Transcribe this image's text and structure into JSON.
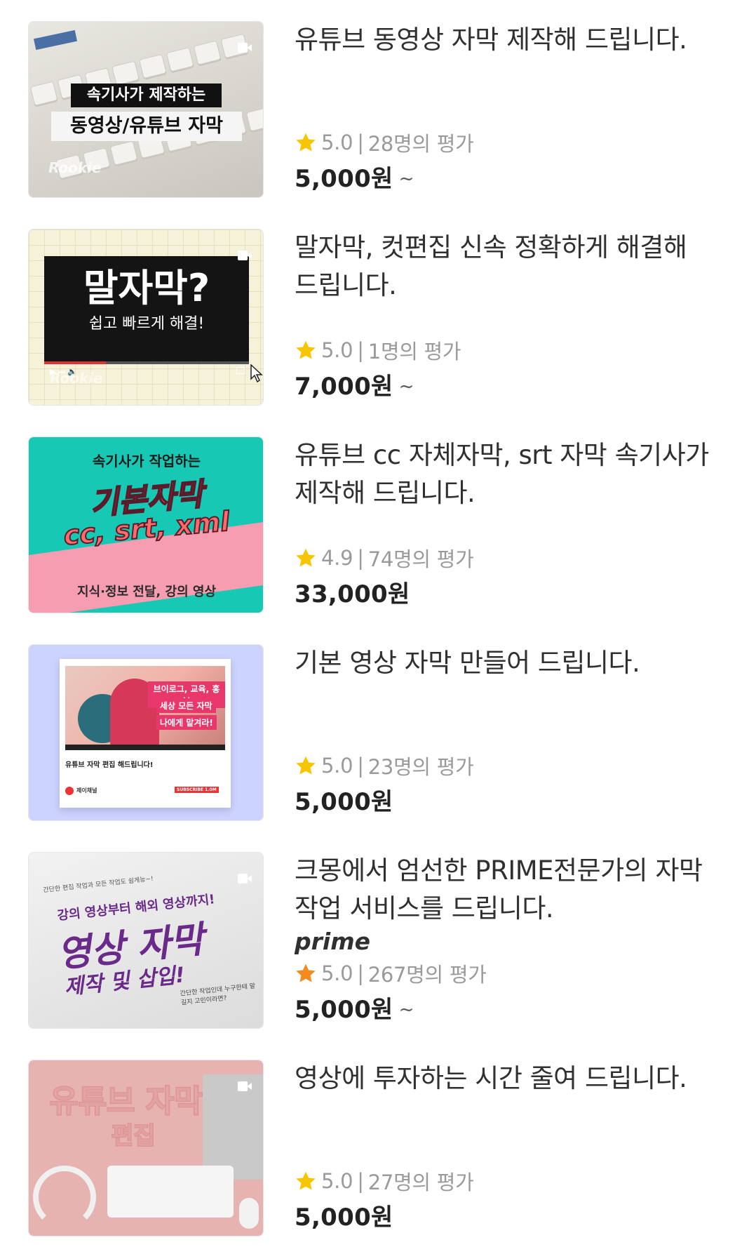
{
  "items": [
    {
      "title": "유튜브 동영상 자막 제작해 드립니다.",
      "rating": "5.0",
      "reviews": "28명의 평가",
      "price": "5,000원",
      "tilde": "~",
      "thumb": {
        "line1": "속기사가 제작하는",
        "line2": "동영상/유튜브 자막",
        "watermark": "Rookie"
      }
    },
    {
      "title": "말자막, 컷편집 신속 정확하게 해결해 드립니다.",
      "rating": "5.0",
      "reviews": "1명의 평가",
      "price": "7,000원",
      "tilde": "~",
      "thumb": {
        "line1": "말자막?",
        "line2": "쉽고 빠르게 해결!",
        "watermark": "Rookie"
      }
    },
    {
      "title": "유튜브 cc 자체자막, srt 자막 속기사가 제작해 드립니다.",
      "rating": "4.9",
      "reviews": "74명의 평가",
      "price": "33,000원",
      "tilde": "",
      "thumb": {
        "line1": "속기사가 작업하는",
        "line2": "기본자막",
        "line3": "cc, srt, xml",
        "line4": "지식·정보 전달, 강의 영상"
      }
    },
    {
      "title": "기본 영상 자막 만들어 드립니다.",
      "rating": "5.0",
      "reviews": "23명의 평가",
      "price": "5,000원",
      "tilde": "",
      "thumb": {
        "tag1": "브이로그, 교육, 홍보",
        "tag2": "세상 모든 자막",
        "tag3": "나에게 맡겨라!",
        "caption": "유튜브 자막 편집 해드립니다!",
        "channel": "제이채널",
        "subscribe": "SUBSCRIBE 1.0M"
      }
    },
    {
      "title": "크몽에서 엄선한 PRIME전문가의 자막 작업 서비스를 드립니다.",
      "badge": "prime",
      "rating": "5.0",
      "reviews": "267명의 평가",
      "price": "5,000원",
      "tilde": "~",
      "thumb": {
        "top": "간단한 편집 작업과 모든 작업도 쉽게능~!",
        "line1": "강의 영상부터 해외 영상까지!",
        "line2": "영상 자막",
        "line3": "제작 및 삽입!",
        "note": "간단한 작업인데 누구한테 맡길지 고민이라면?"
      }
    },
    {
      "title": "영상에 투자하는 시간 줄여 드립니다.",
      "rating": "5.0",
      "reviews": "27명의 평가",
      "price": "5,000원",
      "tilde": "",
      "thumb": {
        "line1": "유튜브 자막",
        "line2": "편집"
      }
    }
  ],
  "colors": {
    "star_default": "#f7c600",
    "star_prime": "#f58a1f",
    "title": "#303030",
    "meta": "#9a9a9a",
    "price": "#222222"
  }
}
